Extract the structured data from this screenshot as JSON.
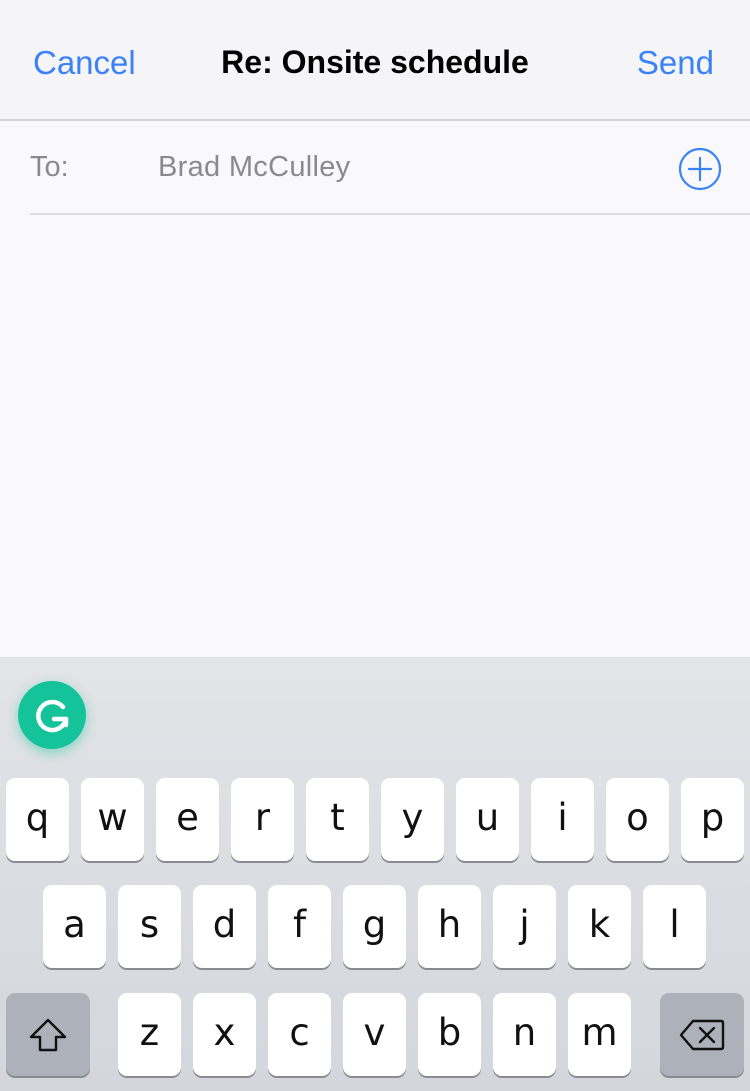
{
  "nav": {
    "cancel_label": "Cancel",
    "title": "Re: Onsite schedule",
    "send_label": "Send"
  },
  "to_field": {
    "label": "To:",
    "recipient": "Brad McCulley"
  },
  "keyboard": {
    "row1": [
      "q",
      "w",
      "e",
      "r",
      "t",
      "y",
      "u",
      "i",
      "o",
      "p"
    ],
    "row2": [
      "a",
      "s",
      "d",
      "f",
      "g",
      "h",
      "j",
      "k",
      "l"
    ],
    "row3": [
      "z",
      "x",
      "c",
      "v",
      "b",
      "n",
      "m"
    ]
  },
  "colors": {
    "accent": "#3a82f6",
    "grammarly": "#15c39a",
    "keyboard_bg": "#d3d6dc"
  },
  "icons": {
    "add_recipient": "plus-circle-icon",
    "grammarly": "grammarly-g-icon",
    "shift": "shift-arrow-icon",
    "backspace": "backspace-icon"
  }
}
